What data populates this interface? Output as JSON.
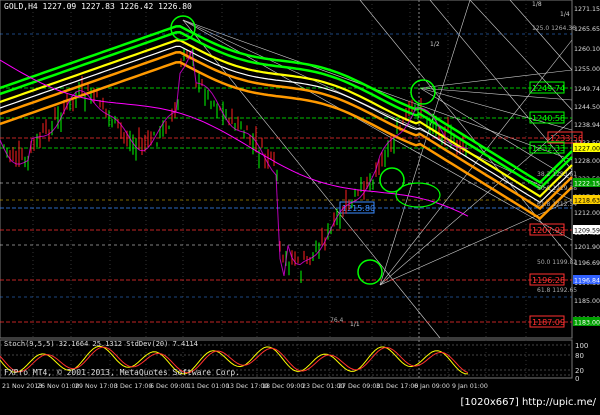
{
  "chart": {
    "header": "GOLD,H4  1227.09 1227.83 1226.42 1226.80",
    "copyright": "FXPro MT4, © 2001-2013, MetaQuotes Software Corp."
  },
  "price_axis": {
    "ticks": [
      "1271.15",
      "1265.65",
      "1260.10",
      "1255.00",
      "1249.74",
      "1244.50",
      "1238.94",
      "1233.50",
      "1228.00",
      "1222.50",
      "1217.24",
      "1212.00",
      "1207.32",
      "1201.90",
      "1196.69",
      "1190.86",
      "1185.00",
      "1180.00"
    ],
    "highlight_tags": [
      {
        "text": "1227.00",
        "color": "#ffff00",
        "fg": "#000"
      },
      {
        "text": "1222.15",
        "color": "#00a000",
        "fg": "#fff"
      },
      {
        "text": "1218.63",
        "color": "#ffd000",
        "fg": "#000"
      },
      {
        "text": "1209.59",
        "color": "#ffffff",
        "fg": "#000"
      },
      {
        "text": "1196.84",
        "color": "#3060ff",
        "fg": "#fff"
      },
      {
        "text": "1183.00",
        "color": "#00a000",
        "fg": "#fff"
      }
    ]
  },
  "levels": [
    {
      "text": "1249.74",
      "color": "#00ff00"
    },
    {
      "text": "1240.58",
      "color": "#00ff00"
    },
    {
      "text": "1233.56",
      "color": "#ff3030"
    },
    {
      "text": "1232.33",
      "color": "#00ff00"
    },
    {
      "text": "1215.80",
      "color": "#3a8cff"
    },
    {
      "text": "1207.92",
      "color": "#ff3030"
    },
    {
      "text": "1196.28",
      "color": "#ff3030"
    },
    {
      "text": "1187.09",
      "color": "#ff3030"
    }
  ],
  "fib_labels": [
    "125.0 1264.36",
    "38.2 1223.61",
    "50.0 1219.38",
    "61.8 1212.54",
    "50.0 1199.82",
    "61.8 1192.65",
    "76.4"
  ],
  "fan_labels": [
    "1/8",
    "1/4",
    "1/2",
    "1/1"
  ],
  "oscillator": {
    "label": "Stoch(9,5,5) 32.1664 25.1312  StdDev(20) 7.4114",
    "ticks": [
      "100",
      "80",
      "20",
      "0"
    ]
  },
  "time_axis": {
    "labels": [
      "21 Nov 2013",
      "26 Nov 01:00",
      "29 Nov 17:00",
      "3 Dec 17:00",
      "6 Dec 09:00",
      "11 Dec 01:00",
      "13 Dec 17:00",
      "18 Dec 09:00",
      "23 Dec 01:00",
      "27 Dec 09:00",
      "31 Dec 17:00",
      "6 Jan 09:00",
      "9 Jan 01:00"
    ]
  },
  "watermark": "[1020x667] http://upic.me/"
}
